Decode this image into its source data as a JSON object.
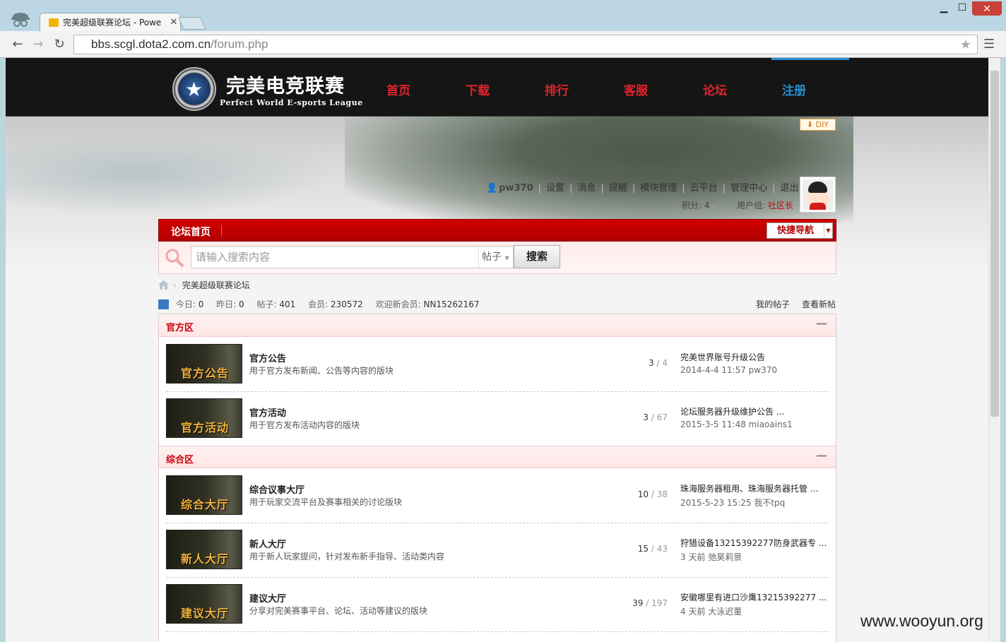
{
  "browser": {
    "tab_title": "完美超级联赛论坛 - Powe",
    "url_host": "bbs.scgl.dota2.com.cn",
    "url_path": "/forum.php"
  },
  "site": {
    "logo_cn": "完美电竞联赛",
    "logo_en": "Perfect World E-sports League",
    "nav": [
      "首页",
      "下载",
      "排行",
      "客服",
      "论坛",
      "注册"
    ],
    "diy_label": "DIY"
  },
  "user": {
    "name": "pw370",
    "links": [
      "设置",
      "消息",
      "提醒",
      "模块管理",
      "云平台",
      "管理中心",
      "退出"
    ],
    "credits_label": "积分: 4",
    "usergroup_label": "用户组:",
    "usergroup_value": "社区长"
  },
  "bar": {
    "home": "论坛首页",
    "quicknav": "快捷导航"
  },
  "search": {
    "placeholder": "请输入搜索内容",
    "type": "帖子",
    "button": "搜索"
  },
  "breadcrumb": "完美超级联赛论坛",
  "stats": [
    {
      "label": "今日:",
      "value": "0"
    },
    {
      "label": "昨日:",
      "value": "0"
    },
    {
      "label": "帖子:",
      "value": "401"
    },
    {
      "label": "会员:",
      "value": "230572"
    },
    {
      "label": "欢迎新会员:",
      "value": "NN15262167"
    }
  ],
  "links": {
    "my_threads": "我的帖子",
    "new_threads": "查看新帖"
  },
  "categories": [
    {
      "title": "官方区",
      "boards": [
        {
          "thumb": "官方公告",
          "name": "官方公告",
          "desc": "用于官方发布新闻、公告等内容的版块",
          "today": "3",
          "total": "4",
          "last_title": "完美世界账号升级公告",
          "last_meta": "2014-4-4 11:57 pw370"
        },
        {
          "thumb": "官方活动",
          "name": "官方活动",
          "desc": "用于官方发布活动内容的版块",
          "today": "3",
          "total": "67",
          "last_title": "论坛服务器升级维护公告 ...",
          "last_meta": "2015-3-5 11:48 miaoains1"
        }
      ]
    },
    {
      "title": "综合区",
      "boards": [
        {
          "thumb": "综合大厅",
          "name": "综合议事大厅",
          "desc": "用于玩家交流平台及赛事相关的讨论版块",
          "today": "10",
          "total": "38",
          "last_title": "珠海服务器租用、珠海服务器托管 ...",
          "last_meta": "2015-5-23 15:25 我不tpq"
        },
        {
          "thumb": "新人大厅",
          "name": "新人大厅",
          "desc": "用于新人玩家提问，针对发布新手指导、活动类内容",
          "today": "15",
          "total": "43",
          "last_title": "狩猎设备13215392277防身武器专 ...",
          "last_meta": "3 天前 弛昊莉景"
        },
        {
          "thumb": "建议大厅",
          "name": "建议大厅",
          "desc": "分享对完美赛事平台、论坛、活动等建议的版块",
          "today": "39",
          "total": "197",
          "last_title": "安徽哪里有进口沙鹰13215392277 ...",
          "last_meta": "4 天前 大泳迟董"
        }
      ]
    }
  ],
  "watermark": "www.wooyun.org",
  "colors": {
    "brand_red": "#c8000a",
    "nav_red": "#e3232a",
    "nav_active_blue": "#2a8fd6"
  }
}
